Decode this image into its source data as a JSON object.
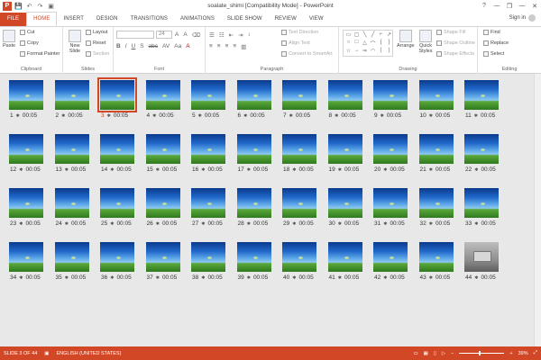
{
  "window": {
    "title": "soalate_shimi [Compatibility Mode] - PowerPoint",
    "controls": [
      "?",
      "—",
      "❐",
      "—",
      "✕"
    ]
  },
  "qat": [
    "P",
    "💾",
    "↶",
    "↷",
    "▣"
  ],
  "tabs": [
    "FILE",
    "HOME",
    "INSERT",
    "DESIGN",
    "TRANSITIONS",
    "ANIMATIONS",
    "SLIDE SHOW",
    "REVIEW",
    "VIEW"
  ],
  "active_tab": "HOME",
  "signin": "Sign in",
  "ribbon": {
    "clipboard": {
      "paste": "Paste",
      "cut": "Cut",
      "copy": "Copy",
      "format_painter": "Format Painter",
      "label": "Clipboard"
    },
    "slides": {
      "new_slide": "New Slide",
      "layout": "Layout",
      "reset": "Reset",
      "section": "Section",
      "label": "Slides"
    },
    "font": {
      "size": "24",
      "label": "Font",
      "format_buttons": [
        "B",
        "I",
        "U",
        "S",
        "abc",
        "AV",
        "Aa",
        "A"
      ]
    },
    "paragraph": {
      "text_direction": "Text Direction",
      "align_text": "Align Text",
      "convert": "Convert to SmartArt",
      "label": "Paragraph"
    },
    "drawing": {
      "arrange": "Arrange",
      "quick_styles": "Quick Styles",
      "shape_fill": "Shape Fill",
      "shape_outline": "Shape Outline",
      "shape_effects": "Shape Effects",
      "label": "Drawing",
      "shapes": [
        "▭",
        "▢",
        "╲",
        "╱",
        "⌐",
        "↗",
        "○",
        "□",
        "△",
        "⌒",
        "{",
        "}",
        "☆",
        "→",
        "⇒",
        "◠",
        "(",
        ")"
      ]
    },
    "editing": {
      "find": "Find",
      "replace": "Replace",
      "select": "Select",
      "label": "Editing"
    }
  },
  "slides": [
    {
      "n": "1",
      "t": "00:05"
    },
    {
      "n": "2",
      "t": "00:05"
    },
    {
      "n": "3",
      "t": "00:05",
      "selected": true
    },
    {
      "n": "4",
      "t": "00:05"
    },
    {
      "n": "5",
      "t": "00:05"
    },
    {
      "n": "6",
      "t": "00:05"
    },
    {
      "n": "7",
      "t": "00:05"
    },
    {
      "n": "8",
      "t": "00:05"
    },
    {
      "n": "9",
      "t": "00:05"
    },
    {
      "n": "10",
      "t": "00:05"
    },
    {
      "n": "11",
      "t": "00:05"
    },
    {
      "n": "12",
      "t": "00:05"
    },
    {
      "n": "13",
      "t": "00:05"
    },
    {
      "n": "14",
      "t": "00:05"
    },
    {
      "n": "15",
      "t": "00:05"
    },
    {
      "n": "16",
      "t": "00:05"
    },
    {
      "n": "17",
      "t": "00:05"
    },
    {
      "n": "18",
      "t": "00:05"
    },
    {
      "n": "19",
      "t": "00:05"
    },
    {
      "n": "20",
      "t": "00:05"
    },
    {
      "n": "21",
      "t": "00:05"
    },
    {
      "n": "22",
      "t": "00:05"
    },
    {
      "n": "23",
      "t": "00:05"
    },
    {
      "n": "24",
      "t": "00:05"
    },
    {
      "n": "25",
      "t": "00:05"
    },
    {
      "n": "26",
      "t": "00:05"
    },
    {
      "n": "27",
      "t": "00:05"
    },
    {
      "n": "28",
      "t": "00:05"
    },
    {
      "n": "29",
      "t": "00:05"
    },
    {
      "n": "30",
      "t": "00:05"
    },
    {
      "n": "31",
      "t": "00:05"
    },
    {
      "n": "32",
      "t": "00:05"
    },
    {
      "n": "33",
      "t": "00:05"
    },
    {
      "n": "34",
      "t": "00:05"
    },
    {
      "n": "35",
      "t": "00:05"
    },
    {
      "n": "36",
      "t": "00:05"
    },
    {
      "n": "37",
      "t": "00:05"
    },
    {
      "n": "38",
      "t": "00:05"
    },
    {
      "n": "39",
      "t": "00:05"
    },
    {
      "n": "40",
      "t": "00:05"
    },
    {
      "n": "41",
      "t": "00:05"
    },
    {
      "n": "42",
      "t": "00:05"
    },
    {
      "n": "43",
      "t": "00:05"
    },
    {
      "n": "44",
      "t": "00:05",
      "photo": true
    }
  ],
  "status": {
    "slide": "SLIDE 3 OF 44",
    "language": "ENGLISH (UNITED STATES)",
    "zoom": "39%"
  },
  "colors": {
    "accent": "#d24726"
  }
}
